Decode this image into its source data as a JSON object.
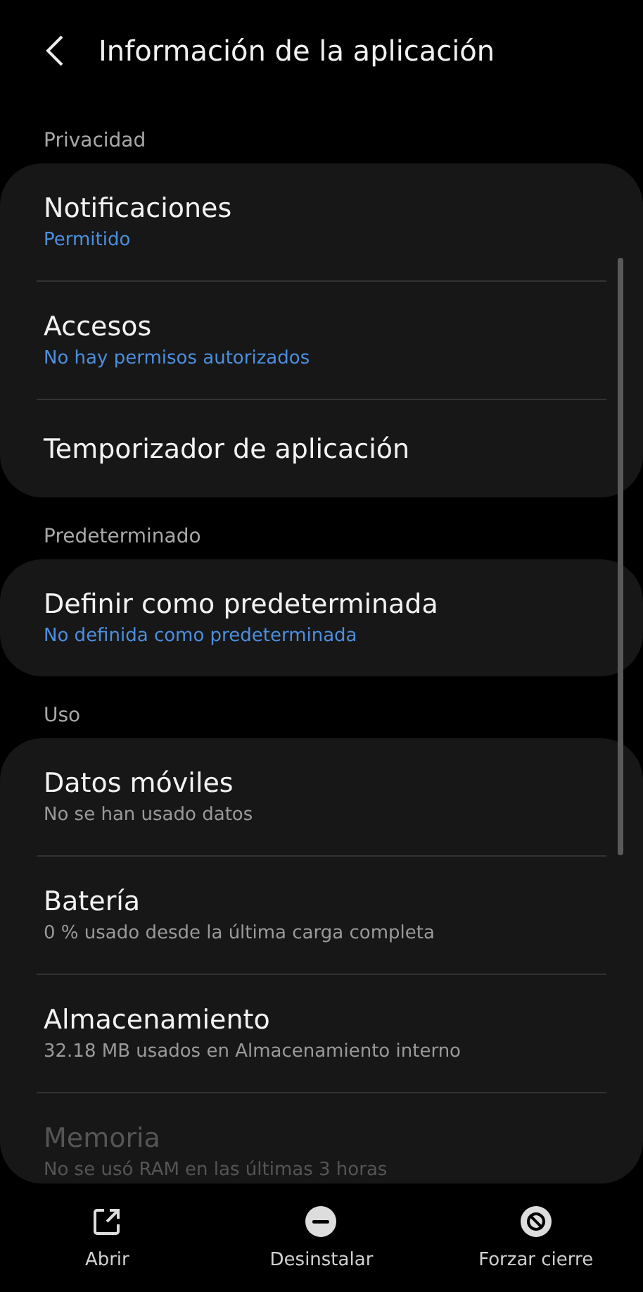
{
  "header": {
    "title": "Información de la aplicación"
  },
  "sections": [
    {
      "label": "Privacidad",
      "items": [
        {
          "title": "Notificaciones",
          "summary": "Permitido",
          "summary_accent": true,
          "dimmed": false
        },
        {
          "title": "Accesos",
          "summary": "No hay permisos autorizados",
          "summary_accent": true,
          "dimmed": false
        },
        {
          "title": "Temporizador de aplicación",
          "dimmed": false
        }
      ]
    },
    {
      "label": "Predeterminado",
      "items": [
        {
          "title": "Definir como predeterminada",
          "summary": "No definida como predeterminada",
          "summary_accent": true,
          "dimmed": false
        }
      ]
    },
    {
      "label": "Uso",
      "items": [
        {
          "title": "Datos móviles",
          "summary": "No se han usado datos",
          "summary_accent": false,
          "dimmed": false
        },
        {
          "title": "Batería",
          "summary": "0 % usado desde la última carga completa",
          "summary_accent": false,
          "dimmed": false
        },
        {
          "title": "Almacenamiento",
          "summary": "32.18 MB usados en Almacenamiento interno",
          "summary_accent": false,
          "dimmed": false
        },
        {
          "title": "Memoria",
          "summary": "No se usó RAM en las últimas 3 horas",
          "summary_accent": false,
          "dimmed": true
        }
      ]
    }
  ],
  "actions": [
    {
      "kind": "open",
      "label": "Abrir"
    },
    {
      "kind": "uninstall",
      "label": "Desinstalar"
    },
    {
      "kind": "force_stop",
      "label": "Forzar cierre"
    }
  ]
}
